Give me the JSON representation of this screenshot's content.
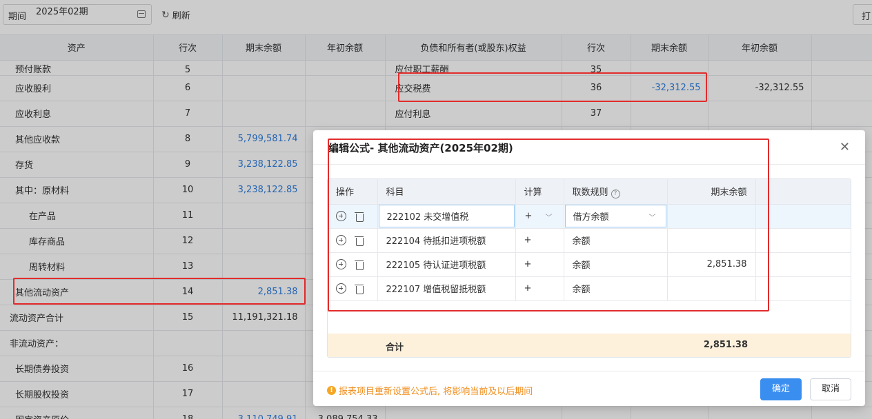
{
  "toolbar": {
    "period_label": "期间",
    "period_value": "2025年02期",
    "refresh_label": "刷新",
    "print_label": "打"
  },
  "sheet": {
    "headers": [
      "资产",
      "行次",
      "期末余额",
      "年初余额",
      "负债和所有者(或股东)权益",
      "行次",
      "期末余额",
      "年初余额"
    ],
    "rows": [
      {
        "asset": "预付账款",
        "line": "5",
        "end": "",
        "begin": "",
        "liab": "应付职工薪酬",
        "lline": "35",
        "lend": "",
        "lbegin": ""
      },
      {
        "asset": "应收股利",
        "line": "6",
        "end": "",
        "begin": "",
        "liab": "应交税费",
        "lline": "36",
        "lend": "-32,312.55",
        "lbegin": "-32,312.55"
      },
      {
        "asset": "应收利息",
        "line": "7",
        "end": "",
        "begin": "",
        "liab": "应付利息",
        "lline": "37",
        "lend": "",
        "lbegin": ""
      },
      {
        "asset": "其他应收款",
        "line": "8",
        "end": "5,799,581.74",
        "begin": "",
        "liab": "",
        "lline": "",
        "lend": "",
        "lbegin": ""
      },
      {
        "asset": "存货",
        "line": "9",
        "end": "3,238,122.85",
        "begin": "",
        "liab": "",
        "lline": "",
        "lend": "",
        "lbegin": ""
      },
      {
        "asset": "其中：原材料",
        "line": "10",
        "end": "3,238,122.85",
        "begin": "",
        "liab": "",
        "lline": "",
        "lend": "",
        "lbegin": ""
      },
      {
        "asset": "在产品",
        "line": "11",
        "end": "",
        "begin": "",
        "liab": "",
        "lline": "",
        "lend": "",
        "lbegin": ""
      },
      {
        "asset": "库存商品",
        "line": "12",
        "end": "",
        "begin": "",
        "liab": "",
        "lline": "",
        "lend": "",
        "lbegin": ""
      },
      {
        "asset": "周转材料",
        "line": "13",
        "end": "",
        "begin": "",
        "liab": "",
        "lline": "",
        "lend": "",
        "lbegin": ""
      },
      {
        "asset": "其他流动资产",
        "line": "14",
        "end": "2,851.38",
        "begin": "",
        "liab": "",
        "lline": "",
        "lend": "",
        "lbegin": ""
      },
      {
        "asset": "流动资产合计",
        "line": "15",
        "end": "11,191,321.18",
        "begin": "",
        "liab": "",
        "lline": "",
        "lend": "",
        "lbegin": ""
      },
      {
        "asset": "非流动资产：",
        "line": "",
        "end": "",
        "begin": "",
        "liab": "",
        "lline": "",
        "lend": "",
        "lbegin": ""
      },
      {
        "asset": "长期债券投资",
        "line": "16",
        "end": "",
        "begin": "",
        "liab": "",
        "lline": "",
        "lend": "",
        "lbegin": ""
      },
      {
        "asset": "长期股权投资",
        "line": "17",
        "end": "",
        "begin": "",
        "liab": "",
        "lline": "",
        "lend": "",
        "lbegin": ""
      },
      {
        "asset": "固定资产原价",
        "line": "18",
        "end": "3,110,749.91",
        "begin": "3,089,754.33",
        "liab": "",
        "lline": "",
        "lend": "",
        "lbegin": ""
      }
    ]
  },
  "modal": {
    "title": "编辑公式- 其他流动资产(2025年02期)",
    "close_symbol": "✕",
    "headers": {
      "ops": "操作",
      "subject": "科目",
      "calc": "计算",
      "rule": "取数规则",
      "end": "期末余额"
    },
    "rows": [
      {
        "subject": "222102 未交增值税",
        "calc": "+",
        "rule": "借方余额",
        "end": ""
      },
      {
        "subject": "222104 待抵扣进项税额",
        "calc": "+",
        "rule": "余额",
        "end": ""
      },
      {
        "subject": "222105 待认证进项税额",
        "calc": "+",
        "rule": "余额",
        "end": "2,851.38"
      },
      {
        "subject": "222107 增值税留抵税额",
        "calc": "+",
        "rule": "余额",
        "end": ""
      }
    ],
    "total_label": "合计",
    "total_value": "2,851.38",
    "warning": "报表项目重新设置公式后, 将影响当前及以后期间",
    "ok_label": "确定",
    "cancel_label": "取消"
  },
  "colors": {
    "link": "#2f7fe0",
    "primary": "#3a8ef0",
    "highlight_box": "#e22b2b",
    "warning": "#f08c1a"
  }
}
